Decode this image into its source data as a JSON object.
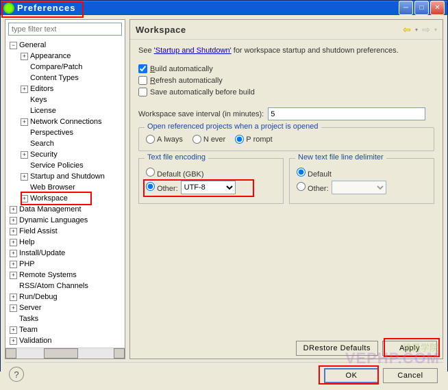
{
  "window": {
    "title": "Preferences"
  },
  "filter": {
    "placeholder": "type filter text"
  },
  "tree": {
    "items": [
      {
        "indent": 0,
        "exp": "−",
        "label": "General"
      },
      {
        "indent": 1,
        "exp": "+",
        "label": "Appearance"
      },
      {
        "indent": 1,
        "exp": "",
        "label": "Compare/Patch"
      },
      {
        "indent": 1,
        "exp": "",
        "label": "Content Types"
      },
      {
        "indent": 1,
        "exp": "+",
        "label": "Editors"
      },
      {
        "indent": 1,
        "exp": "",
        "label": "Keys"
      },
      {
        "indent": 1,
        "exp": "",
        "label": "License"
      },
      {
        "indent": 1,
        "exp": "+",
        "label": "Network Connections"
      },
      {
        "indent": 1,
        "exp": "",
        "label": "Perspectives"
      },
      {
        "indent": 1,
        "exp": "",
        "label": "Search"
      },
      {
        "indent": 1,
        "exp": "+",
        "label": "Security"
      },
      {
        "indent": 1,
        "exp": "",
        "label": "Service Policies"
      },
      {
        "indent": 1,
        "exp": "+",
        "label": "Startup and Shutdown"
      },
      {
        "indent": 1,
        "exp": "",
        "label": "Web Browser"
      },
      {
        "indent": 1,
        "exp": "+",
        "label": "Workspace"
      },
      {
        "indent": 0,
        "exp": "+",
        "label": "Data Management"
      },
      {
        "indent": 0,
        "exp": "+",
        "label": "Dynamic Languages"
      },
      {
        "indent": 0,
        "exp": "+",
        "label": "Field Assist"
      },
      {
        "indent": 0,
        "exp": "+",
        "label": "Help"
      },
      {
        "indent": 0,
        "exp": "+",
        "label": "Install/Update"
      },
      {
        "indent": 0,
        "exp": "+",
        "label": "PHP"
      },
      {
        "indent": 0,
        "exp": "+",
        "label": "Remote Systems"
      },
      {
        "indent": 0,
        "exp": "",
        "label": "RSS/Atom Channels"
      },
      {
        "indent": 0,
        "exp": "+",
        "label": "Run/Debug"
      },
      {
        "indent": 0,
        "exp": "+",
        "label": "Server"
      },
      {
        "indent": 0,
        "exp": "",
        "label": "Tasks"
      },
      {
        "indent": 0,
        "exp": "+",
        "label": "Team"
      },
      {
        "indent": 0,
        "exp": "+",
        "label": "Validation"
      }
    ]
  },
  "header": {
    "title": "Workspace"
  },
  "see": {
    "prefix": "See ",
    "link": "'Startup and Shutdown'",
    "suffix": " for workspace startup and shutdown preferences."
  },
  "checks": {
    "build": "Build automatically",
    "refresh": "Refresh automatically",
    "save": "Save automatically before build"
  },
  "interval": {
    "label": "Workspace save interval (in minutes):",
    "value": "5"
  },
  "group_open": {
    "title": "Open referenced projects when a project is opened",
    "always": "Always",
    "never": "Never",
    "prompt": "Prompt"
  },
  "encoding": {
    "title": "Text file encoding",
    "default_label": "Default (GBK)",
    "other_label": "Other:",
    "other_value": "UTF-8"
  },
  "delimiter": {
    "title": "New text file line delimiter",
    "default_label": "Default",
    "other_label": "Other:"
  },
  "buttons": {
    "restore": "Restore Defaults",
    "apply": "Apply",
    "ok": "OK",
    "cancel": "Cancel"
  },
  "watermark": {
    "sub": "维易学院",
    "main": "VEPHP.COM"
  }
}
